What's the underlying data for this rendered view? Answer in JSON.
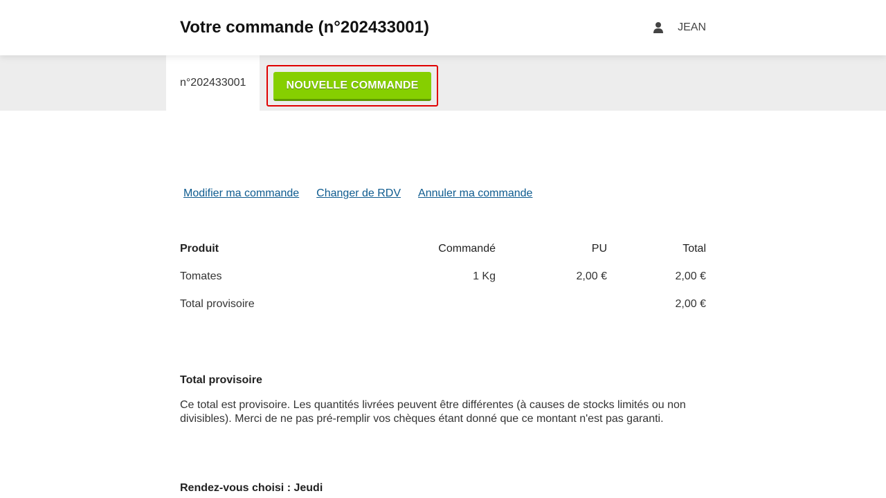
{
  "header": {
    "title": "Votre commande (n°202433001)",
    "user": {
      "icon": "user-icon",
      "name": "JEAN"
    }
  },
  "tabbar": {
    "active_tab": "n°202433001",
    "new_order_button": "NOUVELLE COMMANDE"
  },
  "actions": {
    "modify": "Modifier ma commande",
    "change_rdv": "Changer de RDV",
    "cancel": "Annuler ma commande"
  },
  "table": {
    "headers": [
      "Produit",
      "Commandé",
      "PU",
      "Total"
    ],
    "rows": [
      [
        "Tomates",
        "1 Kg",
        "2,00 €",
        "2,00 €"
      ]
    ],
    "subtotal": {
      "label": "Total provisoire",
      "value": "2,00 €"
    }
  },
  "notice": {
    "title": "Total provisoire",
    "text": "Ce total est provisoire. Les quantités livrées peuvent être différentes (à causes de stocks limités ou non divisibles). Merci de ne pas pré-remplir vos chèques étant donné que ce montant n'est pas garanti."
  },
  "rdv": {
    "text": "Rendez-vous choisi : Jeudi"
  },
  "colors": {
    "accent_button": "#86cf00",
    "link": "#0e5b8f",
    "highlight_border": "#e00000",
    "tabbar_bg": "#ededed"
  }
}
